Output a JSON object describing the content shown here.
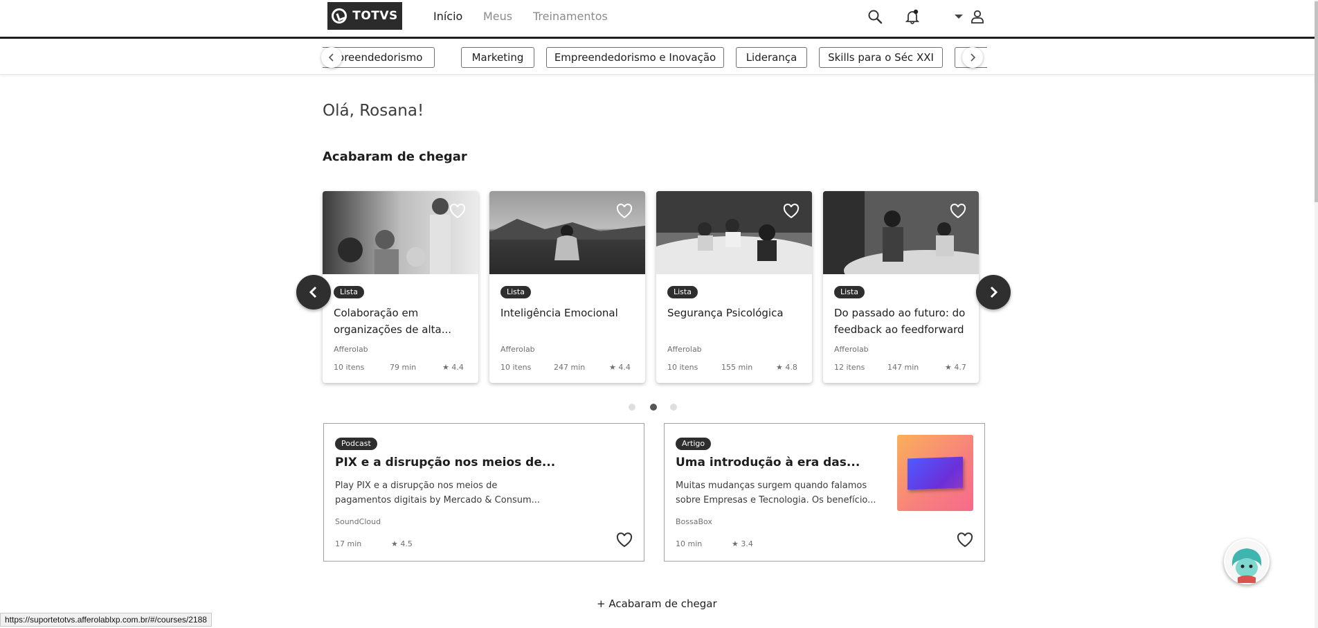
{
  "brand": {
    "name": "TOTVS"
  },
  "nav": {
    "items": [
      {
        "label": "Início",
        "active": true
      },
      {
        "label": "Meus"
      },
      {
        "label": "Treinamentos"
      }
    ]
  },
  "categories": [
    "Empreendedorismo",
    "Marketing",
    "Empreendedorismo e Inovação",
    "Liderança",
    "Skills para o Séc XXI"
  ],
  "greeting": "Olá, Rosana!",
  "section_title": "Acabaram de chegar",
  "cards": [
    {
      "badge": "Lista",
      "title": "Colaboração em organizações de alta...",
      "source": "Afferolab",
      "items": "10 itens",
      "duration": "79 min",
      "rating": "4.4"
    },
    {
      "badge": "Lista",
      "title": "Inteligência Emocional",
      "source": "Afferolab",
      "items": "10 itens",
      "duration": "247 min",
      "rating": "4.4"
    },
    {
      "badge": "Lista",
      "title": "Segurança Psicológica",
      "source": "Afferolab",
      "items": "10 itens",
      "duration": "155 min",
      "rating": "4.8"
    },
    {
      "badge": "Lista",
      "title": "Do passado ao futuro: do feedback ao feedforward",
      "source": "Afferolab",
      "items": "12 itens",
      "duration": "147 min",
      "rating": "4.7"
    }
  ],
  "carousel": {
    "pages": 3,
    "current": 2
  },
  "wide_cards": [
    {
      "badge": "Podcast",
      "title": "PIX e a disrupção nos meios de...",
      "description": "Play PIX e a disrupção nos meios de pagamentos digitais by Mercado & Consum...",
      "source": "SoundCloud",
      "duration": "17 min",
      "rating": "4.5"
    },
    {
      "badge": "Artigo",
      "title": "Uma introdução à era das...",
      "description": "Muitas mudanças surgem quando falamos sobre Empresas e Tecnologia. Os benefício...",
      "source": "BossaBox",
      "duration": "10 min",
      "rating": "3.4"
    }
  ],
  "more_link": "+ Acabaram de chegar",
  "status_url": "https://suportetotvs.afferolablxp.com.br/#/courses/2188",
  "colors": {
    "dark": "#2b2b2b",
    "border": "#a0a0a0"
  }
}
